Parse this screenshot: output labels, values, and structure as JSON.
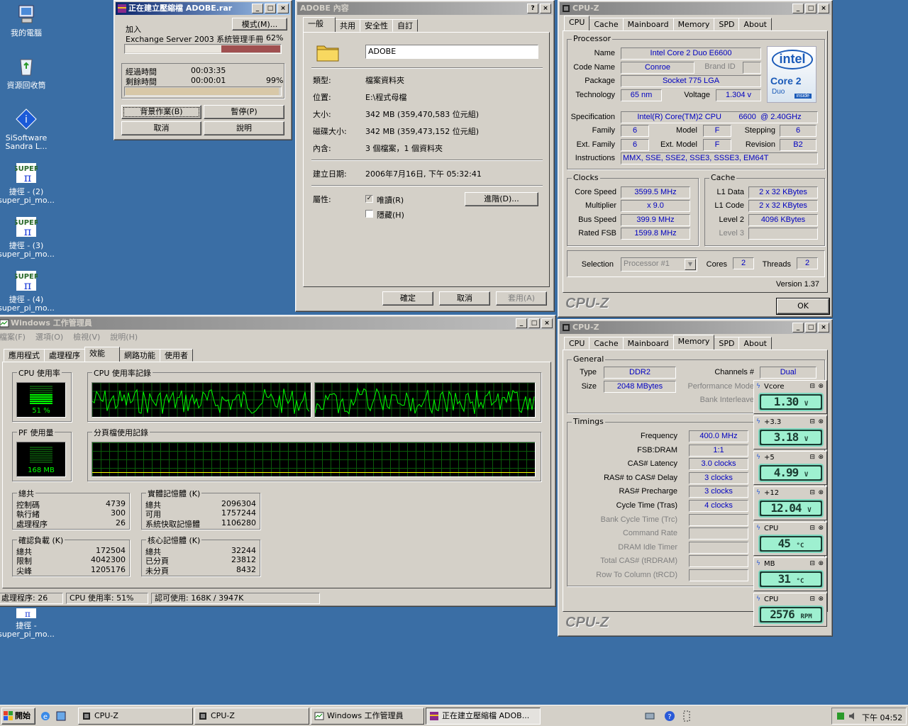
{
  "desktop": {
    "icons": [
      {
        "label": "我的電腦"
      },
      {
        "label": "資源回收筒"
      },
      {
        "label": "SiSoftware Sandra L..."
      },
      {
        "label": "捷徑 - (2) super_pi_mo..."
      },
      {
        "label": "捷徑 - (3) super_pi_mo..."
      },
      {
        "label": "捷徑 - (4) super_pi_mo..."
      },
      {
        "label": "捷徑 - super_pi_mo..."
      }
    ]
  },
  "rar": {
    "title": "正在建立壓縮檔 ADOBE.rar",
    "mode_button": "模式(M)...",
    "adding_label": "加入",
    "file": "Exchange Server 2003 系統管理手冊",
    "file_pct": "62%",
    "file_progress": 0.62,
    "elapsed_label": "經過時間",
    "elapsed": "00:03:35",
    "remaining_label": "剩餘時間",
    "remaining": "00:00:01",
    "total_pct": "99%",
    "total_progress": 0.99,
    "btn_background": "背景作業(B)",
    "btn_pause": "暫停(P)",
    "btn_cancel": "取消",
    "btn_help": "說明"
  },
  "props": {
    "title": "ADOBE 內容",
    "tabs": [
      "一般",
      "共用",
      "安全性",
      "自訂"
    ],
    "name": "ADOBE",
    "rows": [
      {
        "label": "類型:",
        "value": "檔案資料夾"
      },
      {
        "label": "位置:",
        "value": "E:\\程式母檔"
      },
      {
        "label": "大小:",
        "value": "342 MB (359,470,583 位元組)"
      },
      {
        "label": "磁碟大小:",
        "value": "342 MB (359,473,152 位元組)"
      },
      {
        "label": "內含:",
        "value": "3 個檔案，1 個資料夾"
      },
      {
        "label": "建立日期:",
        "value": "2006年7月16日, 下午 05:32:41"
      }
    ],
    "attr_label": "屬性:",
    "readonly": "唯讀(R)",
    "hidden": "隱藏(H)",
    "advanced": "進階(D)...",
    "ok": "確定",
    "cancel": "取消",
    "apply": "套用(A)"
  },
  "cpuz1": {
    "title": "CPU-Z",
    "tabs": [
      "CPU",
      "Cache",
      "Mainboard",
      "Memory",
      "SPD",
      "About"
    ],
    "processor_group": "Processor",
    "name_l": "Name",
    "name": "Intel Core 2 Duo E6600",
    "code_l": "Code Name",
    "code": "Conroe",
    "brand_id": "Brand ID",
    "package_l": "Package",
    "package": "Socket 775 LGA",
    "tech_l": "Technology",
    "tech": "65 nm",
    "voltage_l": "Voltage",
    "voltage": "1.304 v",
    "spec_l": "Specification",
    "spec": "Intel(R) Core(TM)2 CPU        6600  @ 2.40GHz",
    "family_l": "Family",
    "family": "6",
    "model_l": "Model",
    "model": "F",
    "stepping_l": "Stepping",
    "stepping": "6",
    "extfam_l": "Ext. Family",
    "extfam": "6",
    "extmodel_l": "Ext. Model",
    "extmodel": "F",
    "revision_l": "Revision",
    "revision": "B2",
    "instr_l": "Instructions",
    "instr": "MMX, SSE, SSE2, SSE3, SSSE3, EM64T",
    "clocks_group": "Clocks",
    "core_l": "Core Speed",
    "core": "3599.5 MHz",
    "mult_l": "Multiplier",
    "mult": "x 9.0",
    "bus_l": "Bus Speed",
    "bus": "399.9 MHz",
    "fsb_l": "Rated FSB",
    "fsb": "1599.8 MHz",
    "cache_group": "Cache",
    "l1d_l": "L1 Data",
    "l1d": "2 x 32 KBytes",
    "l1c_l": "L1 Code",
    "l1c": "2 x 32 KBytes",
    "l2_l": "Level 2",
    "l2": "4096 KBytes",
    "l3_l": "Level 3",
    "sel_l": "Selection",
    "sel": "Processor #1",
    "cores_l": "Cores",
    "cores": "2",
    "threads_l": "Threads",
    "threads": "2",
    "version": "Version 1.37",
    "logo": "CPU-Z",
    "ok": "OK",
    "intel_logo": "intel",
    "core2_logo": "Core 2",
    "duo_logo": "Duo",
    "inside_logo": "inside"
  },
  "cpuz2": {
    "title": "CPU-Z",
    "tabs": [
      "CPU",
      "Cache",
      "Mainboard",
      "Memory",
      "SPD",
      "About"
    ],
    "general_group": "General",
    "type_l": "Type",
    "type": "DDR2",
    "size_l": "Size",
    "size": "2048 MBytes",
    "channels_l": "Channels #",
    "channels": "Dual",
    "perf_l": "Performance Mode",
    "bank_l": "Bank Interleave",
    "timings_group": "Timings",
    "timings": [
      {
        "label": "Frequency",
        "value": "400.0 MHz",
        "dim": false
      },
      {
        "label": "FSB:DRAM",
        "value": "1:1",
        "dim": false
      },
      {
        "label": "CAS# Latency",
        "value": "3.0 clocks",
        "dim": false
      },
      {
        "label": "RAS# to CAS# Delay",
        "value": "3 clocks",
        "dim": false
      },
      {
        "label": "RAS# Precharge",
        "value": "3 clocks",
        "dim": false
      },
      {
        "label": "Cycle Time (Tras)",
        "value": "4 clocks",
        "dim": false
      },
      {
        "label": "Bank Cycle Time (Trc)",
        "value": "",
        "dim": true
      },
      {
        "label": "Command Rate",
        "value": "",
        "dim": true
      },
      {
        "label": "DRAM Idle Timer",
        "value": "",
        "dim": true
      },
      {
        "label": "Total CAS# (tRDRAM)",
        "value": "",
        "dim": true
      },
      {
        "label": "Row To Column (tRCD)",
        "value": "",
        "dim": true
      }
    ],
    "logo": "CPU-Z"
  },
  "monitors": [
    {
      "name": "Vcore",
      "value": "1.30",
      "unit": "V"
    },
    {
      "name": "+3.3",
      "value": "3.18",
      "unit": "V"
    },
    {
      "name": "+5",
      "value": "4.99",
      "unit": "V"
    },
    {
      "name": "+12",
      "value": "12.04",
      "unit": "V"
    },
    {
      "name": "CPU",
      "value": "45",
      "unit": "°C"
    },
    {
      "name": "MB",
      "value": "31",
      "unit": "°C"
    },
    {
      "name": "CPU",
      "value": "2576",
      "unit": "RPM"
    }
  ],
  "taskmgr": {
    "title": "Windows 工作管理員",
    "menu": [
      "檔案(F)",
      "選項(O)",
      "檢視(V)",
      "說明(H)"
    ],
    "tabs": [
      "應用程式",
      "處理程序",
      "效能",
      "網路功能",
      "使用者"
    ],
    "cpu_usage_label": "CPU 使用率",
    "cpu_usage": "51 %",
    "cpu_usage_value": 51,
    "cpu_history_label": "CPU 使用率記錄",
    "pf_label": "PF 使用量",
    "pf": "168 MB",
    "pf_history_label": "分頁檔使用記錄",
    "totals_label": "總共",
    "handles_l": "控制碼",
    "handles": "4739",
    "threads_l": "執行緒",
    "threads": "300",
    "processes_l": "處理程序",
    "processes": "26",
    "phys_label": "實體記憶體 (K)",
    "phys_total_l": "總共",
    "phys_total": "2096304",
    "phys_avail_l": "可用",
    "phys_avail": "1757244",
    "phys_cache_l": "系統快取記憶體",
    "phys_cache": "1106280",
    "commit_label": "確認負載 (K)",
    "commit_total_l": "總共",
    "commit_total": "172504",
    "commit_limit_l": "限制",
    "commit_limit": "4042300",
    "commit_peak_l": "尖峰",
    "commit_peak": "1205176",
    "kernel_label": "核心記憶體 (K)",
    "kernel_total_l": "總共",
    "kernel_total": "32244",
    "kernel_paged_l": "已分頁",
    "kernel_paged": "23812",
    "kernel_np_l": "未分頁",
    "kernel_np": "8432",
    "status_proc": "處理程序: 26",
    "status_cpu": "CPU 使用率: 51%",
    "status_commit": "認可使用: 168K / 3947K"
  },
  "taskbar": {
    "start": "開始",
    "buttons": [
      "CPU-Z",
      "CPU-Z",
      "Windows 工作管理員",
      "正在建立壓縮檔 ADOB..."
    ],
    "clock": "下午 04:52"
  }
}
